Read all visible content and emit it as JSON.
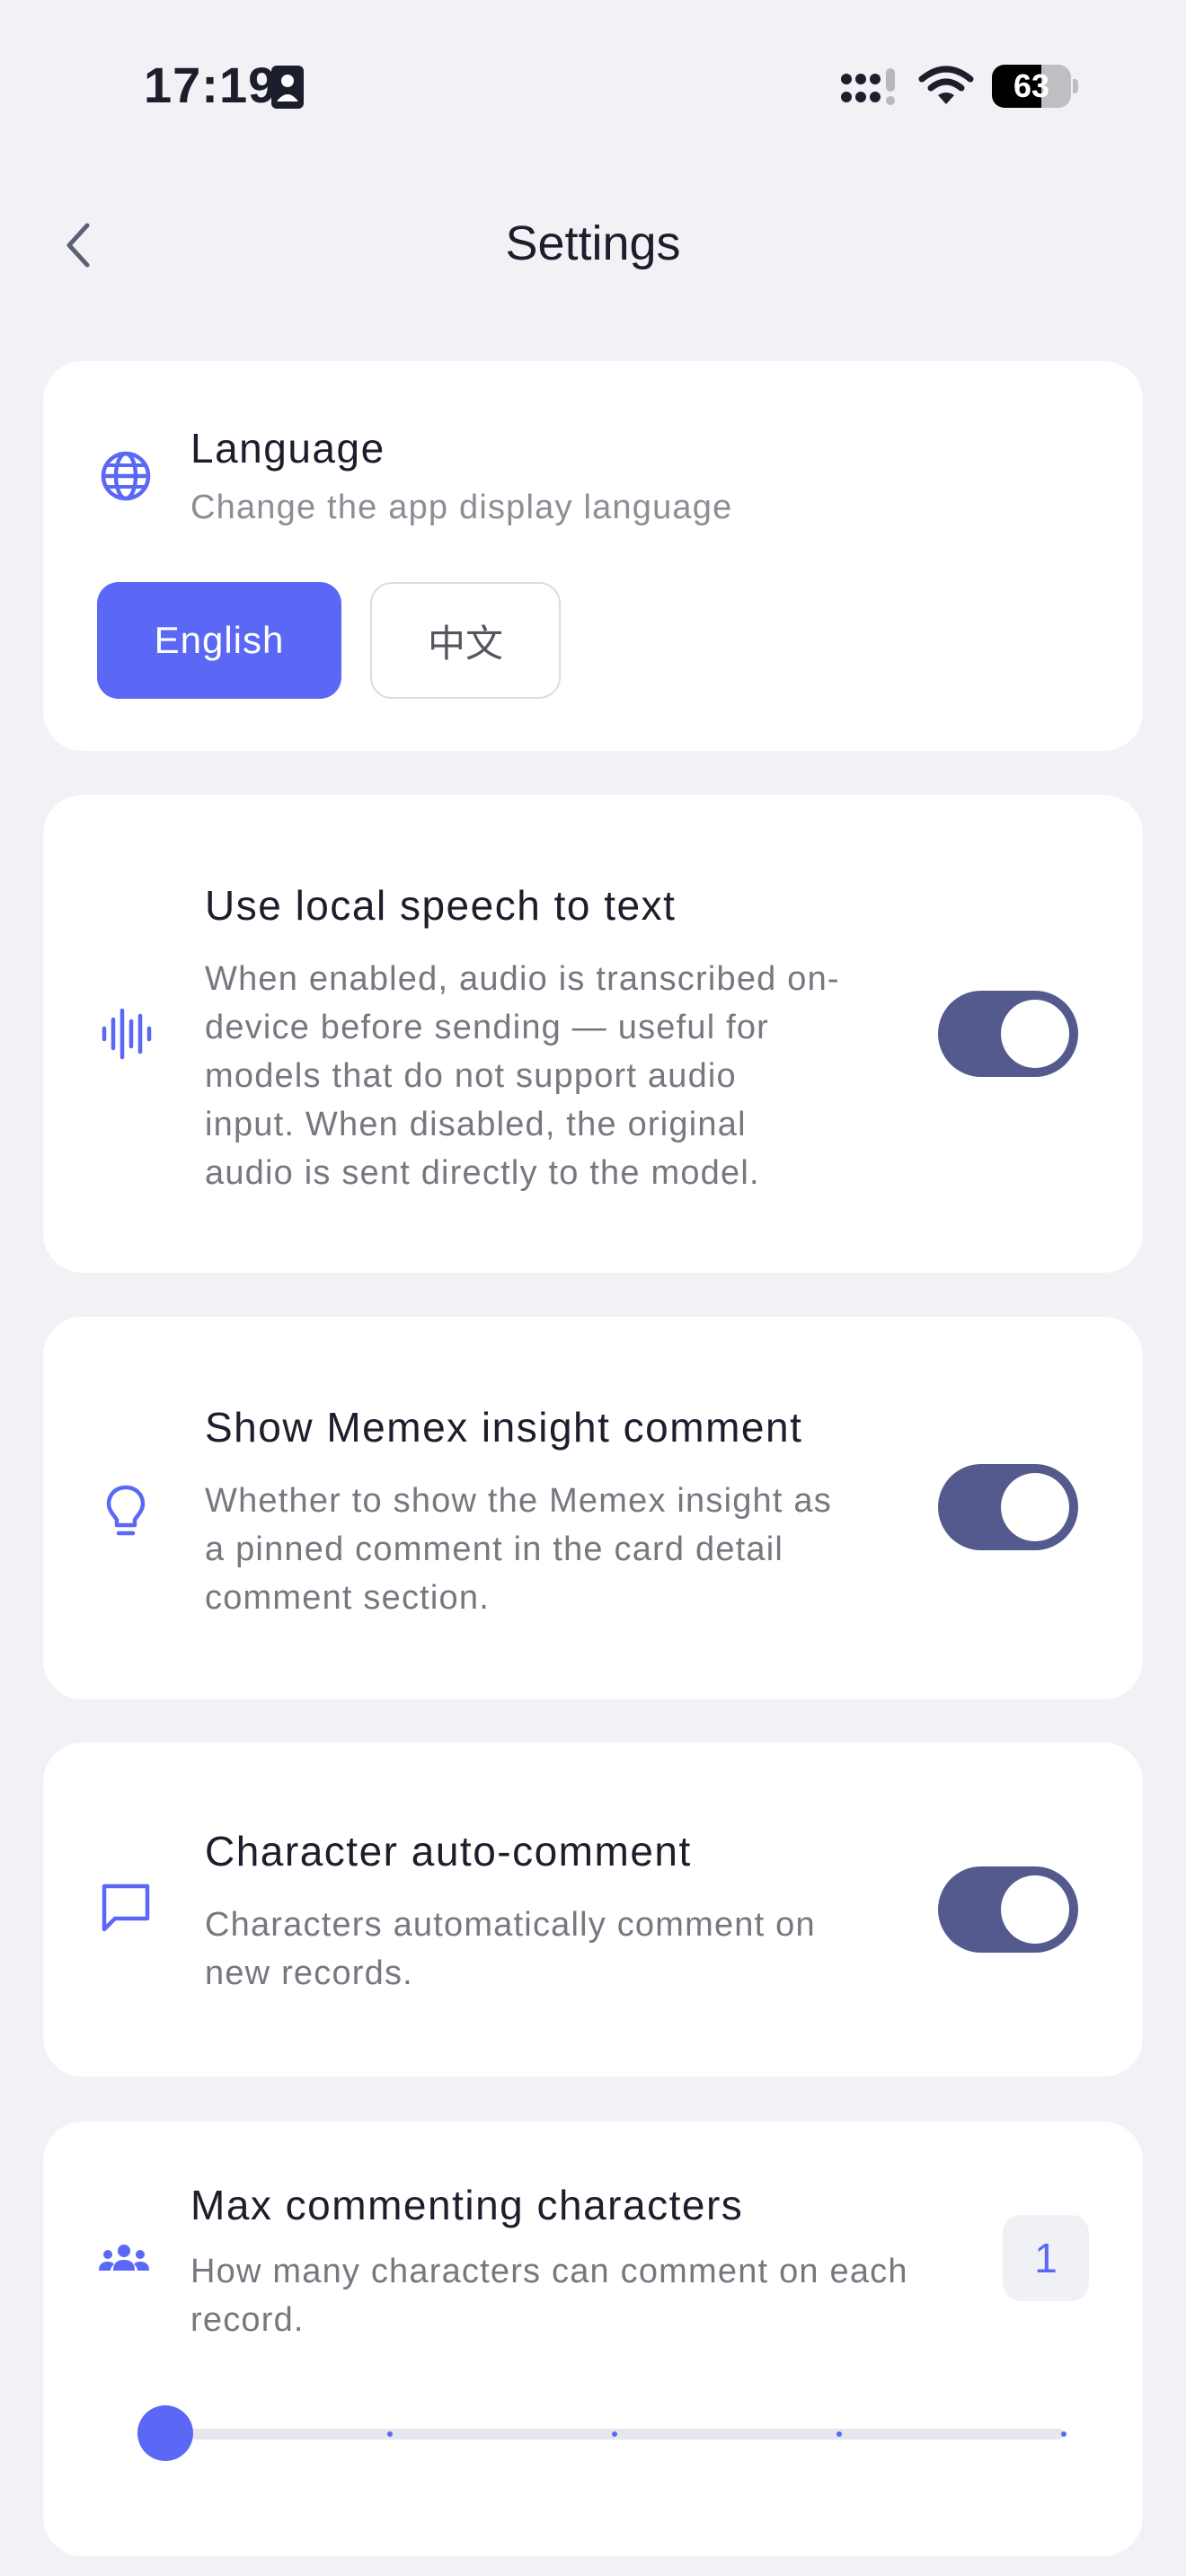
{
  "status_bar": {
    "time": "17:19",
    "battery": 63,
    "battery_label": "63",
    "icons": [
      "contact-card-icon",
      "cellular-signal-icon",
      "wifi-icon",
      "battery-icon"
    ]
  },
  "header": {
    "title": "Settings",
    "back_icon": "chevron-left-icon"
  },
  "language": {
    "icon": "globe-icon",
    "title": "Language",
    "description": "Change the app display language",
    "options": [
      "English",
      "中文"
    ],
    "selected": "English"
  },
  "local_stt": {
    "icon": "waveform-icon",
    "title": "Use local speech to text",
    "description_lines": [
      "When enabled, audio is transcribed on-",
      "device before sending — useful for",
      "models that do not support audio",
      "input. When disabled, the original",
      "audio is sent directly to the model."
    ],
    "enabled": true
  },
  "insight_comment": {
    "icon": "lightbulb-icon",
    "title": "Show Memex insight comment",
    "description_lines": [
      "Whether to show the Memex insight as",
      "a pinned comment in the card detail",
      "comment section."
    ],
    "enabled": true
  },
  "auto_comment": {
    "icon": "chat-bubble-icon",
    "title": "Character auto-comment",
    "description_lines": [
      "Characters automatically comment on",
      "new records."
    ],
    "enabled": true
  },
  "max_characters": {
    "icon": "group-icon",
    "title": "Max commenting characters",
    "description_lines": [
      "How many characters can comment on each",
      "record."
    ],
    "value_label": "1",
    "slider": {
      "min": 1,
      "max": 5,
      "value": 1,
      "steps": 5
    }
  },
  "colors": {
    "accent": "#5b68f6",
    "toggle_on": "#555a8e",
    "background": "#f2f2f6",
    "card": "#ffffff"
  }
}
